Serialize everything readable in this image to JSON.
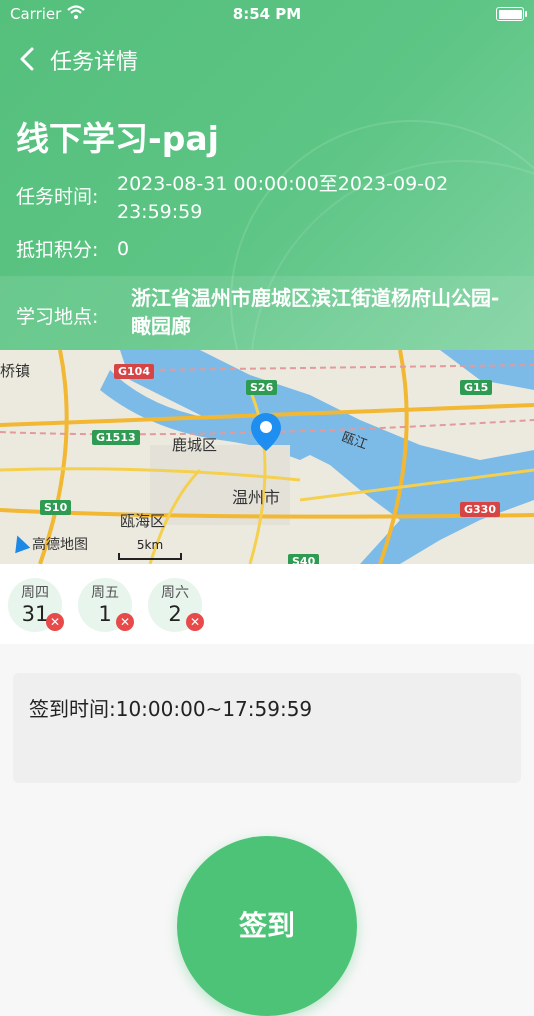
{
  "status_bar": {
    "carrier": "Carrier",
    "time": "8:54 PM"
  },
  "nav": {
    "title": "任务详情",
    "back_icon": "chevron-left-icon"
  },
  "task": {
    "name": "线下学习-paj",
    "time_label": "任务时间:",
    "time_value": "2023-08-31 00:00:00至2023-09-02 23:59:59",
    "points_label": "抵扣积分:",
    "points_value": "0",
    "location_label": "学习地点:",
    "location_value": "浙江省温州市鹿城区滨江街道杨府山公园-瞰园廊"
  },
  "map": {
    "labels": [
      "鹿城区",
      "温州市",
      "瓯海区",
      "瓯江",
      "桥镇"
    ],
    "road_tags": [
      "G104",
      "S26",
      "G15",
      "G1513",
      "S10",
      "G330",
      "S40"
    ],
    "logo_text": "高德地图",
    "scale": "5km",
    "colors": {
      "water": "#7cbbe8",
      "land": "#eceade",
      "highway": "#f2b733",
      "national_road": "#e25a5a",
      "pin": "#1f8ef1"
    }
  },
  "days": [
    {
      "weekday": "周四",
      "date": "31"
    },
    {
      "weekday": "周五",
      "date": "1"
    },
    {
      "weekday": "周六",
      "date": "2"
    }
  ],
  "checkin": {
    "time_text": "签到时间:10:00:00~17:59:59"
  },
  "sign_button": {
    "label": "签到"
  },
  "colors": {
    "accent": "#4cc377",
    "header": "#5dc585",
    "missed": "#e84a4a"
  }
}
